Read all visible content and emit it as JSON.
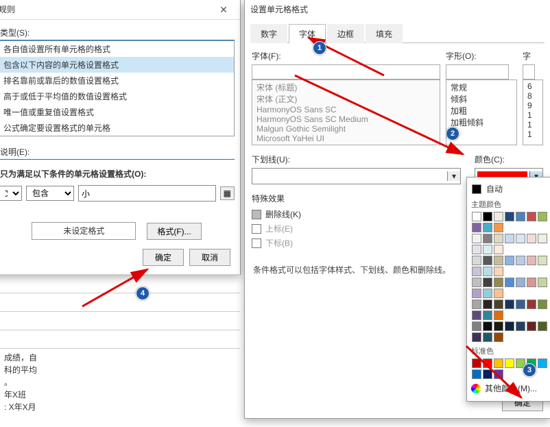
{
  "rule_dialog": {
    "title": "规则",
    "type_label": "类型(S):",
    "options": [
      "各自值设置所有单元格的格式",
      "包含以下内容的单元格设置格式",
      "排名靠前或靠后的数值设置格式",
      "高于或低于平均值的数值设置格式",
      "唯一值或重复值设置格式",
      "公式确定要设置格式的单元格"
    ],
    "desc_label": "说明(E):",
    "cond_label": "只为满足以下条件的单元格设置格式(O):",
    "scope": "文本",
    "operator": "包含",
    "value": "小",
    "preview_label": "未设定格式",
    "format_btn": "格式(F)...",
    "ok": "确定",
    "cancel": "取消"
  },
  "cells_bg": {
    "l1": "成绩，自",
    "l2": "科的平均",
    "l3": "。",
    "l4": "年X班",
    "l5": ": X年X月"
  },
  "format_dialog": {
    "title": "设置单元格格式",
    "tabs": {
      "num": "数字",
      "font": "字体",
      "border": "边框",
      "fill": "填充"
    },
    "font_label": "字体(F):",
    "style_label": "字形(O):",
    "size_label": "字",
    "fonts": [
      "宋体 (标题)",
      "宋体 (正文)",
      "HarmonyOS Sans SC",
      "HarmonyOS Sans SC Medium",
      "Malgun Gothic Semilight",
      "Microsoft YaHei UI"
    ],
    "styles": [
      "常规",
      "倾斜",
      "加粗",
      "加粗倾斜"
    ],
    "sizes": [
      "6",
      "8",
      "9",
      "1",
      "1",
      "1"
    ],
    "underline_label": "下划线(U):",
    "color_label": "颜色(C):",
    "effects_label": "特殊效果",
    "strike": "删除线(K)",
    "sup": "上标(E)",
    "sub": "下标(B)",
    "note": "条件格式可以包括字体样式、下划线、颜色和删除线。",
    "ok": "确定"
  },
  "color_popup": {
    "auto": "自动",
    "theme": "主题颜色",
    "standard": "标准色",
    "more": "其他颜色(M)...",
    "theme_row1": [
      "#ffffff",
      "#000000",
      "#eeece1",
      "#1f497d",
      "#4f81bd",
      "#c0504d",
      "#9bbb59",
      "#8064a2",
      "#4bacc6",
      "#f79646"
    ],
    "shade_rows": [
      [
        "#f2f2f2",
        "#7f7f7f",
        "#ddd9c3",
        "#c6d9f0",
        "#dbe5f1",
        "#f2dcdb",
        "#ebf1dd",
        "#e5e0ec",
        "#dbeef3",
        "#fdeada"
      ],
      [
        "#d9d9d9",
        "#595959",
        "#c4bd97",
        "#8db3e2",
        "#b8cce4",
        "#e5b9b7",
        "#d7e3bc",
        "#ccc1d9",
        "#b7dde8",
        "#fbd5b5"
      ],
      [
        "#bfbfbf",
        "#404040",
        "#938953",
        "#548dd4",
        "#95b3d7",
        "#d99694",
        "#c3d69b",
        "#b2a2c7",
        "#92cddc",
        "#fac08f"
      ],
      [
        "#a6a6a6",
        "#262626",
        "#494429",
        "#17365d",
        "#366092",
        "#953734",
        "#76923c",
        "#5f497a",
        "#31859b",
        "#e36c09"
      ],
      [
        "#808080",
        "#0d0d0d",
        "#1d1b10",
        "#0f243e",
        "#244061",
        "#632423",
        "#4f6128",
        "#3f3151",
        "#205867",
        "#974806"
      ]
    ],
    "standard_row": [
      "#c00000",
      "#ff0000",
      "#ffc000",
      "#ffff00",
      "#92d050",
      "#00b050",
      "#00b0f0",
      "#0070c0",
      "#002060",
      "#7030a0"
    ]
  }
}
